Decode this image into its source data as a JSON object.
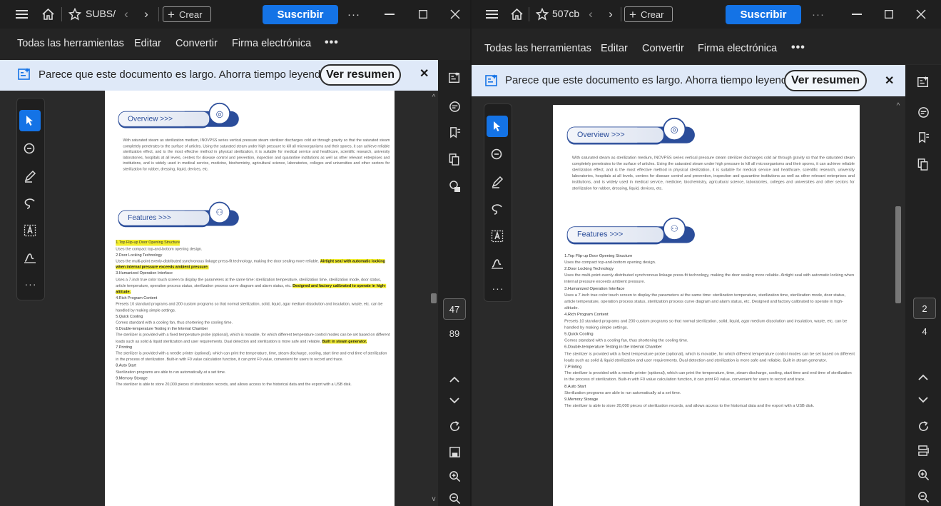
{
  "windows": [
    {
      "id": "left",
      "title": "SUBS/",
      "create_label": "Crear",
      "subscribe_label": "Suscribir",
      "menu": [
        "Todas las herramientas",
        "Editar",
        "Convertir",
        "Firma electrónica"
      ],
      "banner_text": "Parece que este documento es largo. Ahorra tiempo leyend...",
      "summary_label": "Ver resumen",
      "page_current": "47",
      "page_total": "89"
    },
    {
      "id": "right",
      "title": "507cb",
      "create_label": "Crear",
      "subscribe_label": "Suscribir",
      "menu": [
        "Todas las herramientas",
        "Editar",
        "Convertir",
        "Firma electrónica"
      ],
      "banner_text": "Parece que este documento es largo. Ahorra tiempo leyend...",
      "summary_label": "Ver resumen",
      "page_current": "2",
      "page_total": "4"
    }
  ],
  "document": {
    "overview_heading": "Overview >>>",
    "overview_text": "With saturated steam as sterilization medium, INOVPSS series vertical pressure steam sterilizer discharges cold air through gravity so that the saturated steam completely penetrates to the surface of articles. Using the saturated steam under high pressure to kill all microorganisms and their spores, it can achieve reliable sterilization effect, and is the most effective method in physical sterilization, it is suitable for medical service and healthcare, scientific research, university laboratories, hospitals at all levels, centers for disease control and prevention, inspection and quarantine institutions as well as other relevant enterprises and institutions, and is widely used in medical service, medicine, biochemistry, agricultural science, laboratories, colleges and universities and other sectors for sterilization for rubber, dressing, liquid, devices, etc.",
    "features_heading": "Features >>>",
    "features": [
      {
        "title": "1.Top Flip-up Door Opening Structure",
        "text": "Uses the compact top-and-bottom opening design."
      },
      {
        "title": "2.Door Locking Technology",
        "text": "Uses the multi-point evenly-distributed synchronous linkage press-fit technology, making the door sealing more reliable.",
        "highlight": "Airtight seal with automatic locking when internal pressure exceeds ambient pressure."
      },
      {
        "title": "3.Humanized Operation Interface",
        "text": "Uses a 7-inch true color touch screen to display the parameters at the same time: sterilization temperature, sterilization time, sterilization mode, door status, article temperature, operation process status, sterilization process curve diagram and alarm status, etc.",
        "highlight": "Designed and factory calibrated to operate in high-altitude."
      },
      {
        "title": "4.Rich Program Content",
        "text": "Presets 10 standard programs and 200 custom programs so that normal sterilization, solid, liquid, agar medium dissolution and insulation, waste, etc. can be handled by making simple settings."
      },
      {
        "title": "5.Quick Cooling",
        "text": "Comes standard with a cooling fan, thus shortening the cooling time."
      },
      {
        "title": "6.Double-temperature Testing in the Internal Chamber",
        "text": "The sterilizer is provided with a fixed temperature probe (optional), which is movable, for which different temperature control modes can be set based on different loads such as solid & liquid sterilization and user requirements. Dual detection and sterilization is more safe and reliable.",
        "highlight": "Built in steam generator."
      },
      {
        "title": "7.Printing",
        "text": "The sterilizer is provided with a needle printer (optional), which can print the temperature, time, steam discharge, cooling, start time and end time of sterilization in the process of sterilization. Built-in with F0 value calculation function, it can print F0 value, convenient for users to record and trace."
      },
      {
        "title": "8.Auto Start",
        "text": "Sterilization programs are able to run automatically at a set time."
      },
      {
        "title": "9.Memory Storage",
        "text": "The sterilizer is able to store 20,000 pieces of sterilization records, and allows access to the historical data and the export with a USB disk."
      }
    ]
  }
}
